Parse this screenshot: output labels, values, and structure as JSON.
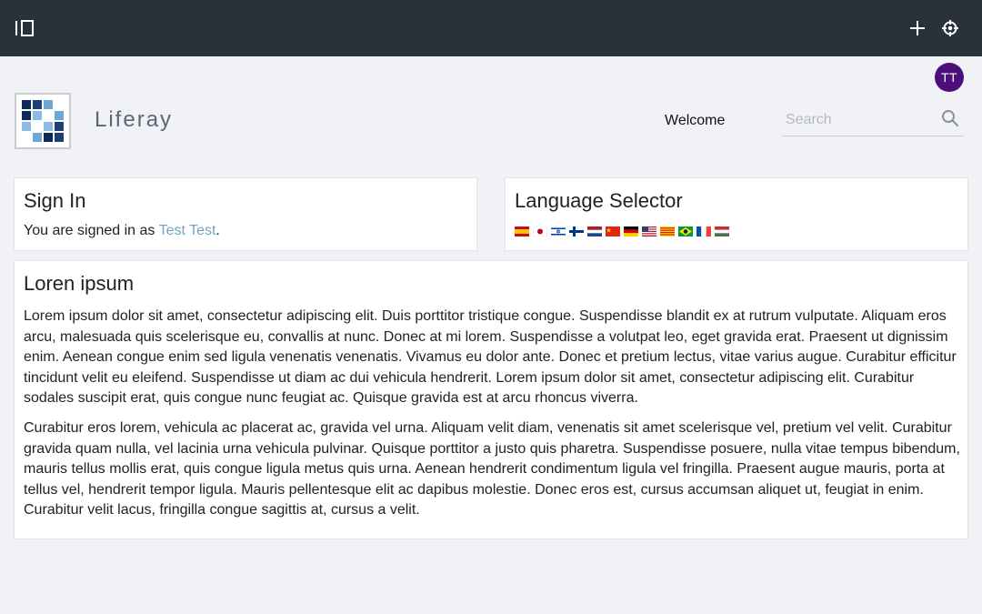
{
  "topbar": {
    "sidebar_toggle_icon": "sidebar-toggle-icon",
    "add_icon": "plus-icon",
    "simulation_icon": "simulation-icon"
  },
  "user": {
    "initials": "TT"
  },
  "header": {
    "site_name": "Liferay",
    "nav_welcome": "Welcome",
    "search": {
      "placeholder": "Search",
      "value": ""
    }
  },
  "sign_in": {
    "title": "Sign In",
    "message_prefix": "You are signed in as ",
    "user_name": "Test Test",
    "message_suffix": "."
  },
  "language_selector": {
    "title": "Language Selector",
    "flags": [
      "es_ES",
      "ja_JP",
      "iw_IL",
      "fi_FI",
      "nl_NL",
      "zh_CN",
      "de_DE",
      "en_US",
      "ca_ES",
      "pt_BR",
      "fr_FR",
      "hu_HU"
    ]
  },
  "article": {
    "title": "Loren ipsum",
    "paragraphs": [
      "Lorem ipsum dolor sit amet, consectetur adipiscing elit. Duis porttitor tristique congue. Suspendisse blandit ex at rutrum vulputate. Aliquam eros arcu, malesuada quis scelerisque eu, convallis at nunc. Donec at mi lorem. Suspendisse a volutpat leo, eget gravida erat. Praesent ut dignissim enim. Aenean congue enim sed ligula venenatis venenatis. Vivamus eu dolor ante. Donec et pretium lectus, vitae varius augue. Curabitur efficitur tincidunt velit eu eleifend. Suspendisse ut diam ac dui vehicula hendrerit. Lorem ipsum dolor sit amet, consectetur adipiscing elit. Curabitur sodales suscipit erat, quis congue nunc feugiat ac. Quisque gravida est at arcu rhoncus viverra.",
      "Curabitur eros lorem, vehicula ac placerat ac, gravida vel urna. Aliquam velit diam, venenatis sit amet scelerisque vel, pretium vel velit. Curabitur gravida quam nulla, vel lacinia urna vehicula pulvinar. Quisque porttitor a justo quis pharetra. Suspendisse posuere, nulla vitae tempus bibendum, mauris tellus mollis erat, quis congue ligula metus quis urna. Aenean hendrerit condimentum ligula vel fringilla. Praesent augue mauris, porta at tellus vel, hendrerit tempor ligula. Mauris pellentesque elit ac dapibus molestie. Donec eros est, cursus accumsan aliquet ut, feugiat in enim. Curabitur velit lacus, fringilla congue sagittis at, cursus a velit."
    ]
  },
  "colors": {
    "topbar_bg": "#29323b",
    "avatar_bg": "#4b0e7a",
    "link": "#6fa6c8",
    "page_bg": "#f1f2f5"
  }
}
